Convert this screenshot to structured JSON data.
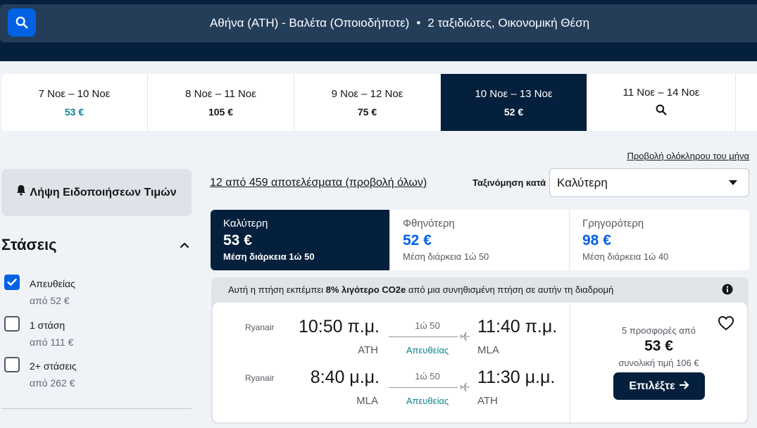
{
  "header": {
    "route": "Αθήνα (ATH) - Βαλέτα (Οποιοδήποτε)",
    "separator": "•",
    "travellers": "2 ταξιδιώτες, Οικονομική Θέση"
  },
  "dates": [
    {
      "range": "7 Νοε – 10 Νοε",
      "price": "53 €"
    },
    {
      "range": "8 Νοε – 11 Νοε",
      "price": "105 €"
    },
    {
      "range": "9 Νοε – 12 Νοε",
      "price": "75 €"
    },
    {
      "range": "10 Νοε – 13 Νοε",
      "price": "52 €"
    },
    {
      "range": "11 Νοε – 14 Νοε"
    }
  ],
  "whole_month_link": "Προβολή ολόκληρου του μήνα",
  "sidebar": {
    "alert_button": "Λήψη Ειδοποιήσεων Τιμών",
    "stops_title": "Στάσεις",
    "stops": [
      {
        "label": "Απευθείας",
        "from": "από 52 €",
        "checked": true
      },
      {
        "label": "1 στάση",
        "from": "από 111 €",
        "checked": false
      },
      {
        "label": "2+ στάσεις",
        "from": "από 262 €",
        "checked": false
      }
    ]
  },
  "results": {
    "count": "12 από 459 αποτελέσματα (προβολή όλων)",
    "sort_label": "Ταξινόμηση κατά",
    "sort_value": "Καλύτερη"
  },
  "tabs": [
    {
      "title": "Καλύτερη",
      "price": "53 €",
      "sub": "Μέση διάρκεια 1ώ 50"
    },
    {
      "title": "Φθηνότερη",
      "price": "52 €",
      "sub": "Μέση διάρκεια 1ώ 50"
    },
    {
      "title": "Γρηγορότερη",
      "price": "98 €",
      "sub": "Μέση διάρκεια 1ώ 40"
    }
  ],
  "eco": {
    "pre": "Αυτή η πτήση εκπέμπει ",
    "bold": "8% λιγότερο CO2e",
    "post": " από μια συνηθισμένη πτήση σε αυτήν τη διαδρομή"
  },
  "flight": {
    "legs": [
      {
        "airline": "Ryanair",
        "dep_time": "10:50 π.μ.",
        "dep_code": "ATH",
        "duration": "1ώ 50",
        "stops": "Απευθείας",
        "arr_time": "11:40 π.μ.",
        "arr_code": "MLA"
      },
      {
        "airline": "Ryanair",
        "dep_time": "8:40 μ.μ.",
        "dep_code": "MLA",
        "duration": "1ώ 50",
        "stops": "Απευθείας",
        "arr_time": "11:30 μ.μ.",
        "arr_code": "ATH"
      }
    ],
    "offers": "5 προσφορές από",
    "price": "53 €",
    "total": "συνολική τιμή 106 €",
    "select_label": "Επιλέξτε"
  },
  "colors": {
    "navy": "#05203c",
    "blue": "#0062e3",
    "teal": "#0c838a"
  }
}
